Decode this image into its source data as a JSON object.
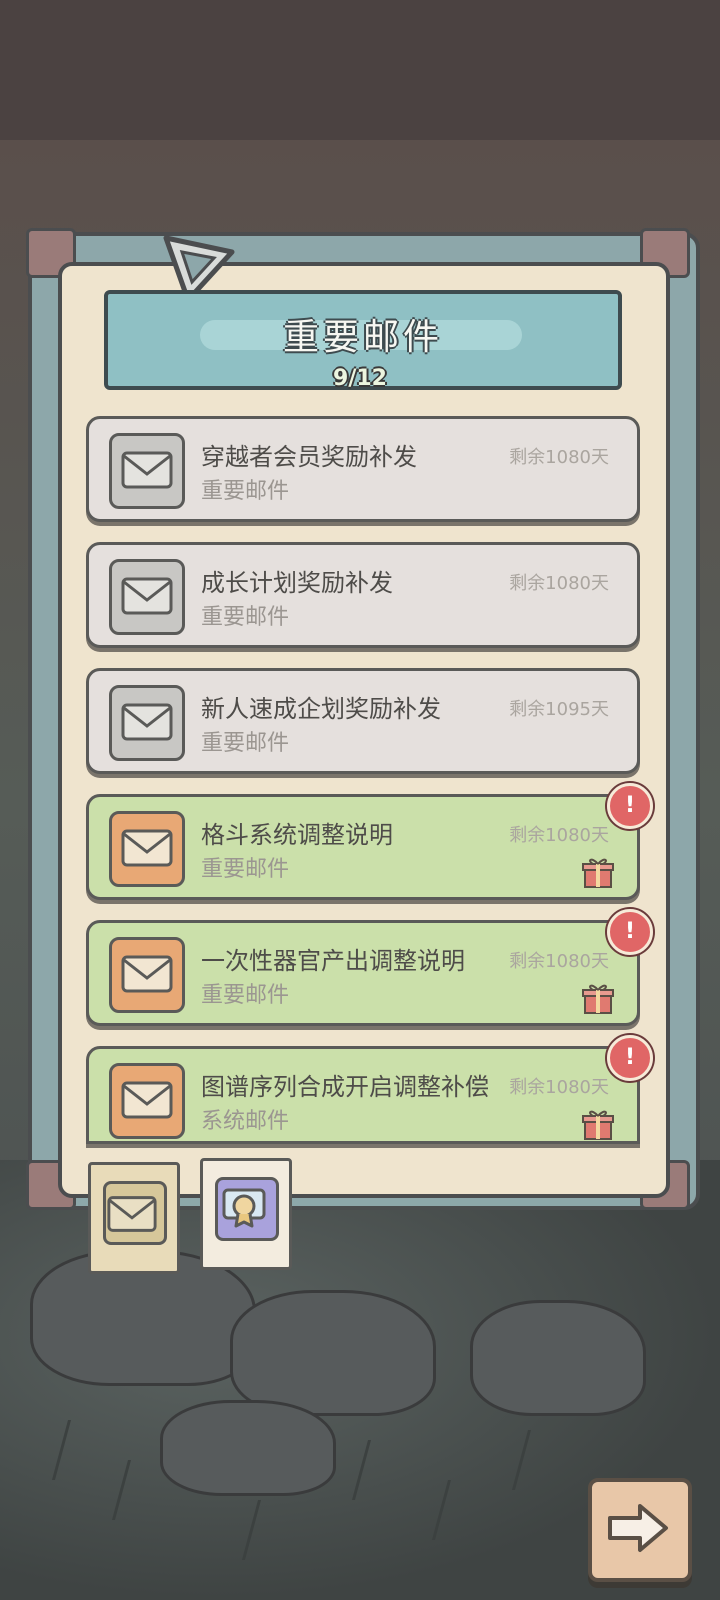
{
  "header": {
    "title": "重要邮件",
    "counter": "9/12"
  },
  "mails": [
    {
      "title": "穿越者会员奖励补发",
      "subtitle": "重要邮件",
      "remaining": "剩余1080天",
      "state": "read"
    },
    {
      "title": "成长计划奖励补发",
      "subtitle": "重要邮件",
      "remaining": "剩余1080天",
      "state": "read"
    },
    {
      "title": "新人速成企划奖励补发",
      "subtitle": "重要邮件",
      "remaining": "剩余1095天",
      "state": "read"
    },
    {
      "title": "格斗系统调整说明",
      "subtitle": "重要邮件",
      "remaining": "剩余1080天",
      "state": "unread"
    },
    {
      "title": "一次性器官产出调整说明",
      "subtitle": "重要邮件",
      "remaining": "剩余1080天",
      "state": "unread"
    },
    {
      "title": "图谱序列合成开启调整补偿",
      "subtitle": "系统邮件",
      "remaining": "剩余1080天",
      "state": "unread"
    }
  ],
  "badges": {
    "alert": "!"
  },
  "icons": {
    "mail": "envelope-icon",
    "gift": "gift-icon",
    "alert": "exclamation-icon",
    "tab_mail": "envelope-icon",
    "tab_reward": "medal-icon",
    "next": "arrow-right-icon"
  },
  "colors": {
    "read_item": "#e5e0dd",
    "unread_item": "#cbe0aa",
    "title_bar": "#8fc0c4",
    "alert": "#e06666"
  }
}
